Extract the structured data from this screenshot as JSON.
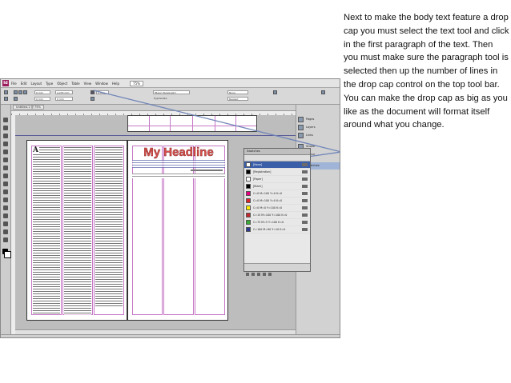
{
  "app": {
    "logo_text": "Id",
    "menu": [
      "File",
      "Edit",
      "Layout",
      "Type",
      "Object",
      "Table",
      "View",
      "Window",
      "Help"
    ],
    "zoom": "75%",
    "document_tab": "Untitled-1 @ 75%",
    "control_fields": [
      "0 mm",
      "0 mm",
      "4.233 mm",
      "[Basic Paragraph]",
      "Hyphenate",
      "None",
      "Ragged",
      "0 mm",
      "0 mm"
    ]
  },
  "side_panel": {
    "items": [
      "Pages",
      "Layers",
      "Links",
      "Stroke",
      "Colour",
      "Swatches"
    ],
    "active_index": 5
  },
  "document": {
    "drop_cap": "A",
    "headline": "My Headline",
    "headline_color": "#d9504b"
  },
  "swatches_panel": {
    "title": "Swatches",
    "tint_label": "Tint:",
    "tint_value": "100",
    "items": [
      {
        "name": "[None]",
        "color": "#ffffff",
        "selected": true
      },
      {
        "name": "[Registration]",
        "color": "#000000",
        "selected": false
      },
      {
        "name": "[Paper]",
        "color": "#ffffff",
        "selected": false
      },
      {
        "name": "[Black]",
        "color": "#000000",
        "selected": false
      },
      {
        "name": "C=0 M=100 Y=0 K=0",
        "color": "#e6007e",
        "selected": false
      },
      {
        "name": "C=0 M=100 Y=0 K=0",
        "color": "#d8232a",
        "selected": false
      },
      {
        "name": "C=0 M=0 Y=100 K=0",
        "color": "#ffed00",
        "selected": false
      },
      {
        "name": "C=15 M=100 Y=100 K=0",
        "color": "#c1272d",
        "selected": false
      },
      {
        "name": "C=75 M=5 Y=100 K=0",
        "color": "#3aaa35",
        "selected": false
      },
      {
        "name": "C=100 M=90 Y=10 K=0",
        "color": "#2b3990",
        "selected": false
      }
    ]
  },
  "caption": "Next to make the body text feature a drop cap you must select the text tool and click in the first paragraph of the text. Then you must make sure the paragraph tool is selected then up the number of lines in the drop cap control on the top tool bar. You can make the drop cap as big as you like as the document will format itself around what you change."
}
